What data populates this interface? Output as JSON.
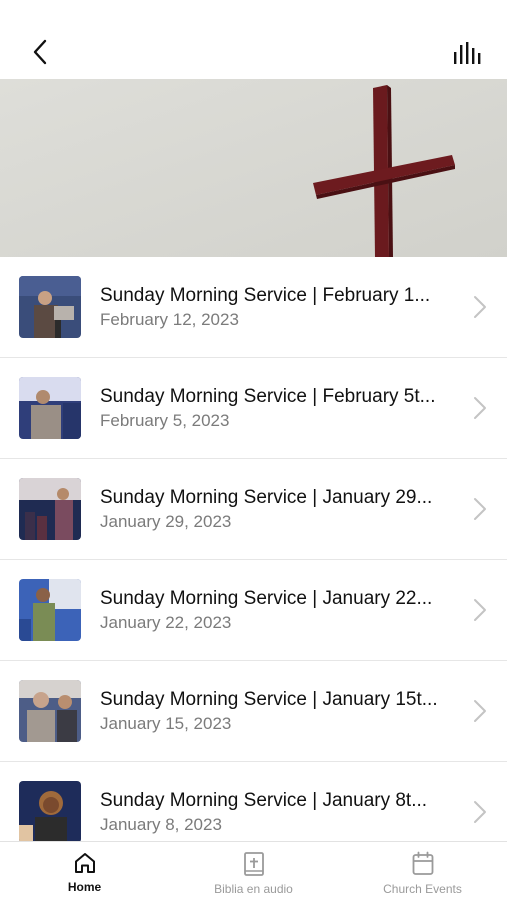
{
  "header": {
    "back_icon": "chevron-left-icon",
    "audio_icon": "audio-bars-icon"
  },
  "hero": {
    "image": "cross-against-sky"
  },
  "services": [
    {
      "title": "Sunday Morning Service | February 1...",
      "date": "February 12, 2023",
      "thumb_colors": [
        "#3a4d7a",
        "#7d6a5b",
        "#c9b7a8"
      ]
    },
    {
      "title": "Sunday Morning Service | February 5t...",
      "date": "February 5, 2023",
      "thumb_colors": [
        "#2f3e7a",
        "#9a8f86",
        "#e6e1dc"
      ]
    },
    {
      "title": "Sunday Morning Service | January 29...",
      "date": "January 29, 2023",
      "thumb_colors": [
        "#1f2b52",
        "#7a4b5f",
        "#d9d3d6"
      ]
    },
    {
      "title": "Sunday Morning Service | January 22...",
      "date": "January 22, 2023",
      "thumb_colors": [
        "#3c63b8",
        "#7a8c55",
        "#e0e4ee"
      ]
    },
    {
      "title": "Sunday Morning Service | January 15t...",
      "date": "January 15, 2023",
      "thumb_colors": [
        "#4d5d87",
        "#a29991",
        "#d6d2cf"
      ]
    },
    {
      "title": "Sunday Morning Service | January 8t...",
      "date": "January 8, 2023",
      "thumb_colors": [
        "#1e2c5a",
        "#a06a3b",
        "#e1c4a2"
      ]
    }
  ],
  "tabs": [
    {
      "label": "Home",
      "icon": "home-icon",
      "active": true
    },
    {
      "label": "Biblia en audio",
      "icon": "bible-icon",
      "active": false
    },
    {
      "label": "Church Events",
      "icon": "calendar-icon",
      "active": false
    }
  ]
}
